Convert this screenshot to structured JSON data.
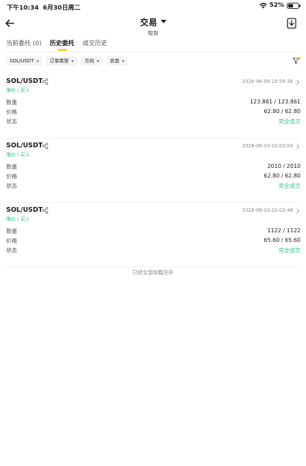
{
  "status_bar": {
    "time": "下午10:34",
    "date": "6月30日周二",
    "battery": "52%",
    "battery_level": 0.52
  },
  "header": {
    "title": "交易",
    "subtitle": "现货"
  },
  "tabs": [
    {
      "label": "当前委托 (0)",
      "active": false
    },
    {
      "label": "历史委托",
      "active": true
    },
    {
      "label": "成交历史",
      "active": false
    }
  ],
  "filters": [
    "SOL/USDT",
    "订单类型",
    "方向",
    "状态"
  ],
  "orders": [
    {
      "pair": "SOL/USDT",
      "kind": "限价 / 买入",
      "time": "2026-06-08 16:59:38",
      "qty_label": "数量",
      "qty": "123.861 / 123.861",
      "price_label": "价格",
      "price": "62.80 / 62.80",
      "status_label": "状态",
      "status": "完全成交"
    },
    {
      "pair": "SOL/USDT",
      "kind": "限价 / 买入",
      "time": "2026-06-03 02:03:04",
      "qty_label": "数量",
      "qty": "2010 / 2010",
      "price_label": "价格",
      "price": "62.80 / 62.80",
      "status_label": "状态",
      "status": "完全成交"
    },
    {
      "pair": "SOL/USDT",
      "kind": "限价 / 买入",
      "time": "2026-06-03 02:02:48",
      "qty_label": "数量",
      "qty": "1122 / 1122",
      "price_label": "价格",
      "price": "65.60 / 65.60",
      "status_label": "状态",
      "status": "完全成交"
    }
  ],
  "footer_note": "已经全部加载完毕",
  "colors": {
    "accent": "#f0b90b",
    "buy_green": "#2ebd85"
  }
}
